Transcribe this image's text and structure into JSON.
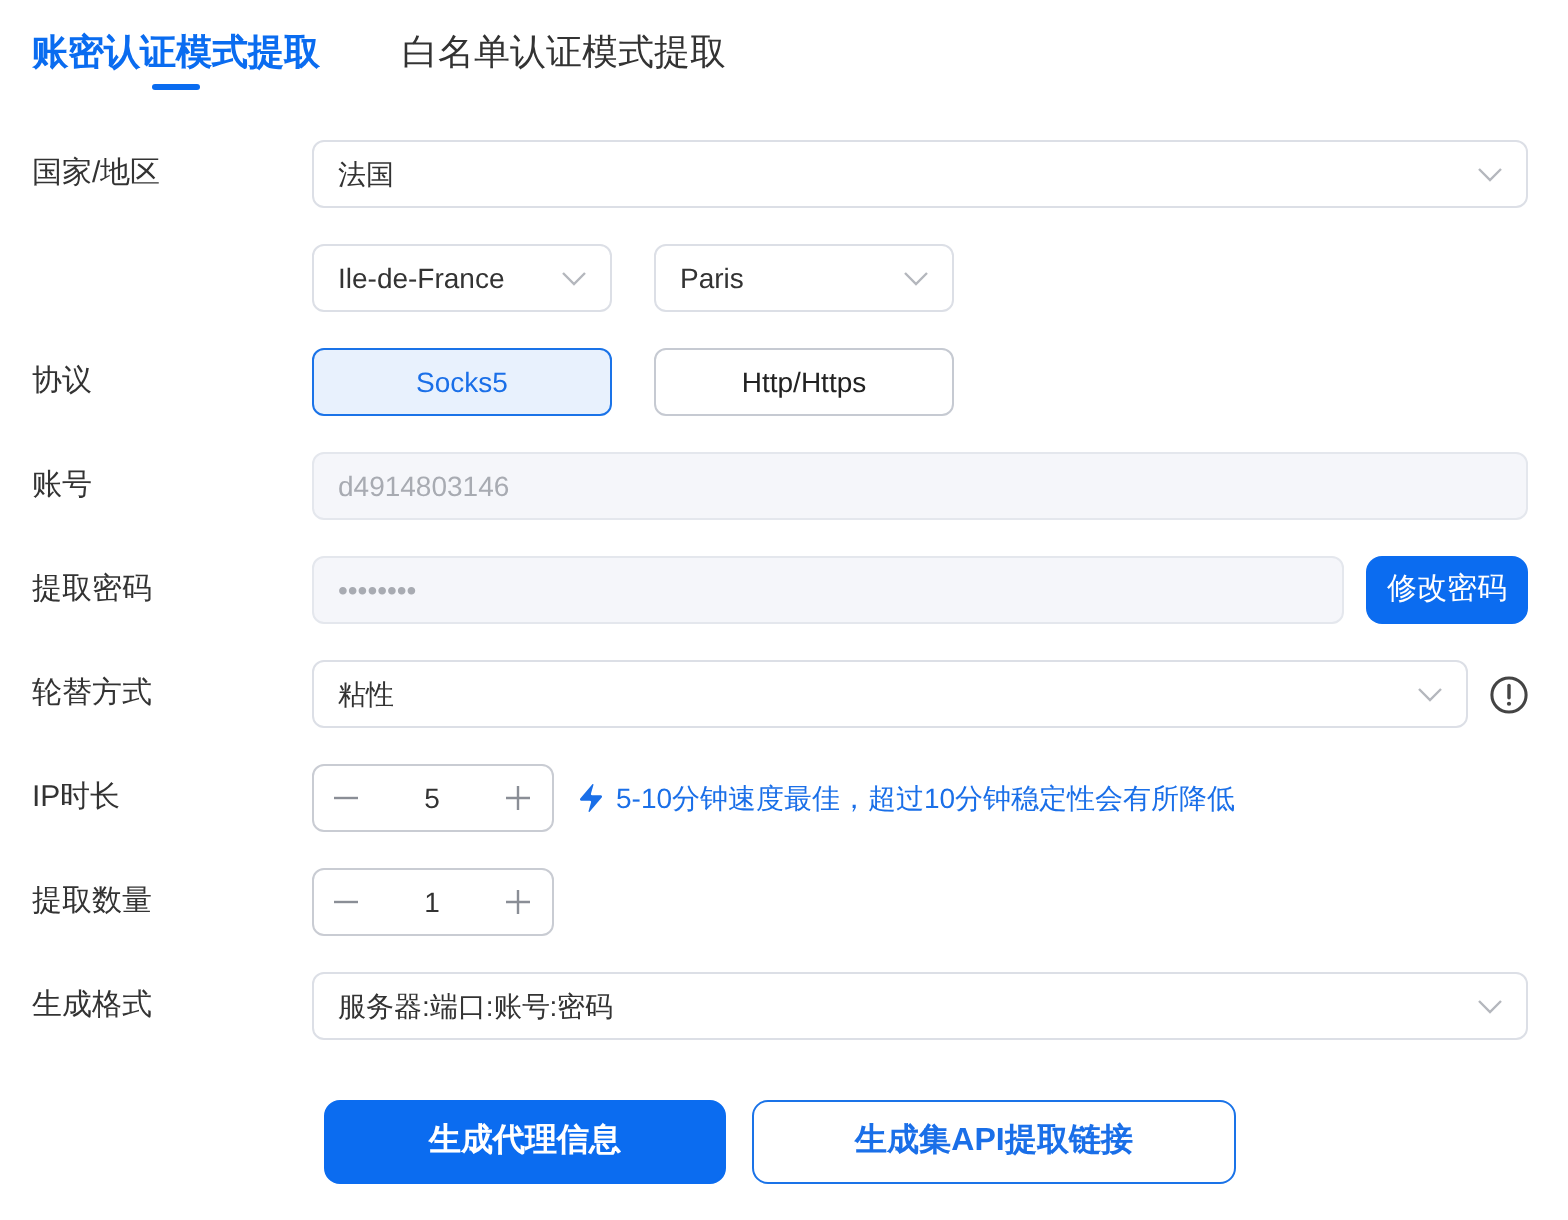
{
  "tabs": [
    {
      "label": "账密认证模式提取",
      "selected": true
    },
    {
      "label": "白名单认证模式提取",
      "selected": false
    }
  ],
  "rows": [
    {
      "kind": "select",
      "label": "国家/地区",
      "value": "法国"
    },
    {
      "kind": "select_pair",
      "values": [
        "Ile-de-France",
        "Paris"
      ]
    },
    {
      "kind": "options",
      "label": "协议",
      "options": [
        {
          "label": "Socks5",
          "selected": true
        },
        {
          "label": "Http/Https",
          "selected": false
        }
      ]
    },
    {
      "kind": "text",
      "label": "账号",
      "value": "d4914803146",
      "disabled": true
    },
    {
      "kind": "password",
      "label": "提取密码",
      "value": "••••••••",
      "disabled": true,
      "button": "修改密码"
    },
    {
      "kind": "select",
      "label": "轮替方式",
      "value": "粘性",
      "info": true
    },
    {
      "kind": "stepper",
      "label": "IP时长",
      "value": "5",
      "hint": "5-10分钟速度最佳，超过10分钟稳定性会有所降低"
    },
    {
      "kind": "stepper",
      "label": "提取数量",
      "value": "1"
    },
    {
      "kind": "select",
      "label": "生成格式",
      "value": "服务器:端口:账号:密码"
    }
  ],
  "actions": [
    {
      "label": "生成代理信息",
      "kind": "primary"
    },
    {
      "label": "生成集API提取链接",
      "kind": "outline"
    }
  ]
}
